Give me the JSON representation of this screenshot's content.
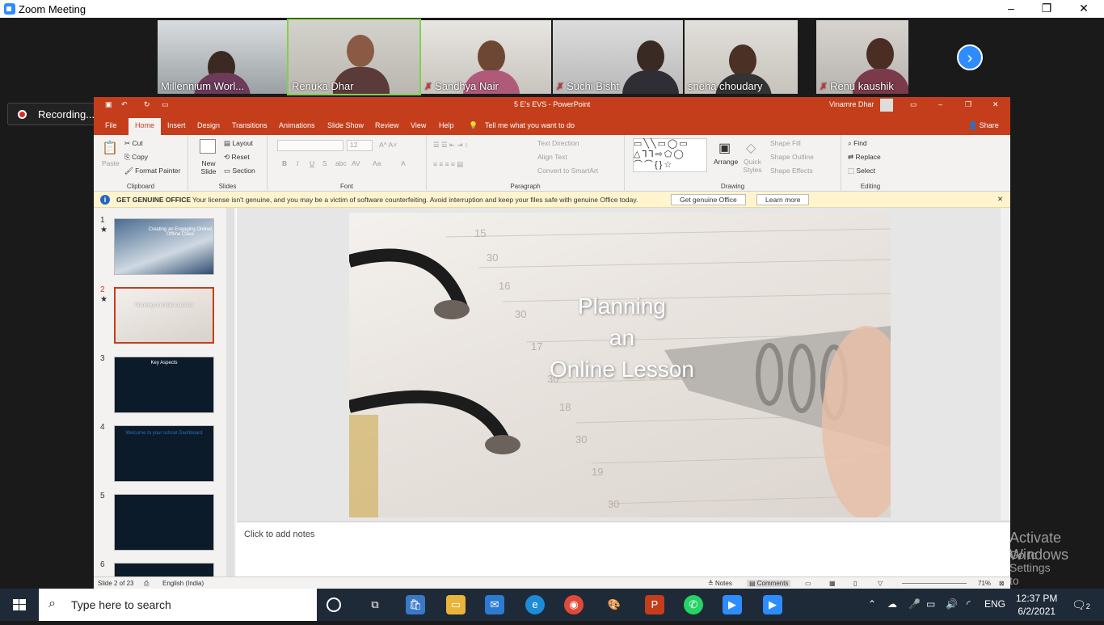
{
  "zoom": {
    "title": "Zoom Meeting",
    "recording": "Recording...",
    "participants": [
      {
        "name": "Millennium Worl...",
        "muted": false
      },
      {
        "name": "Renuka Dhar",
        "muted": false
      },
      {
        "name": "Sandhya Nair",
        "muted": true
      },
      {
        "name": "Suchi Bisht",
        "muted": true
      },
      {
        "name": "sneha choudary",
        "muted": false
      },
      {
        "name": "Renu kaushik",
        "muted": true
      }
    ],
    "window_controls": {
      "minimize": "–",
      "maximize": "❐",
      "close": "✕"
    }
  },
  "ppt": {
    "doc_title": "5 E's EVS  -  PowerPoint",
    "user": "Vinamre Dhar",
    "tabs": [
      "File",
      "Home",
      "Insert",
      "Design",
      "Transitions",
      "Animations",
      "Slide Show",
      "Review",
      "View",
      "Help"
    ],
    "active_tab": "Home",
    "tell_me": "Tell me what you want to do",
    "share": "Share",
    "ribbon": {
      "clipboard": {
        "label": "Clipboard",
        "paste": "Paste",
        "cut": "Cut",
        "copy": "Copy",
        "format_painter": "Format Painter"
      },
      "slides": {
        "label": "Slides",
        "new_slide": "New Slide",
        "layout": "Layout",
        "reset": "Reset",
        "section": "Section"
      },
      "font": {
        "label": "Font",
        "size": "12"
      },
      "paragraph": {
        "label": "Paragraph",
        "text_direction": "Text Direction",
        "align_text": "Align Text",
        "smartart": "Convert to SmartArt"
      },
      "drawing": {
        "label": "Drawing",
        "arrange": "Arrange",
        "quick_styles": "Quick Styles",
        "shape_fill": "Shape Fill",
        "shape_outline": "Shape Outline",
        "shape_effects": "Shape Effects"
      },
      "editing": {
        "label": "Editing",
        "find": "Find",
        "replace": "Replace",
        "select": "Select"
      }
    },
    "genuine_bar": {
      "heading": "GET GENUINE OFFICE",
      "message": "Your license isn't genuine, and you may be a victim of software counterfeiting. Avoid interruption and keep your files safe with genuine Office today.",
      "button1": "Get genuine Office",
      "button2": "Learn more"
    },
    "thumbnails": [
      {
        "num": "1",
        "star": "★",
        "text": "Creating an Engaging Online/ Offline Class"
      },
      {
        "num": "2",
        "star": "★",
        "text": "Planning an Online Lesson"
      },
      {
        "num": "3",
        "star": "",
        "text": "Key Aspects"
      },
      {
        "num": "4",
        "star": "",
        "text": "Welcome to your school Dashboard"
      },
      {
        "num": "5",
        "star": "",
        "text": ""
      },
      {
        "num": "6",
        "star": "",
        "text": ""
      }
    ],
    "slide_title_lines": [
      "Planning",
      "an",
      "Online Lesson"
    ],
    "notes_placeholder": "Click to add notes",
    "watermark1": "Activate Windows",
    "watermark2": "Go to Settings to activate Windows.",
    "status": {
      "slide_count": "Slide 2 of 23",
      "language": "English (India)",
      "notes": "Notes",
      "comments": "Comments",
      "zoom": "71%"
    }
  },
  "taskbar": {
    "search_placeholder": "Type here to search",
    "lang": "ENG",
    "time": "12:37 PM",
    "date": "6/2/2021",
    "notifications": "2"
  }
}
